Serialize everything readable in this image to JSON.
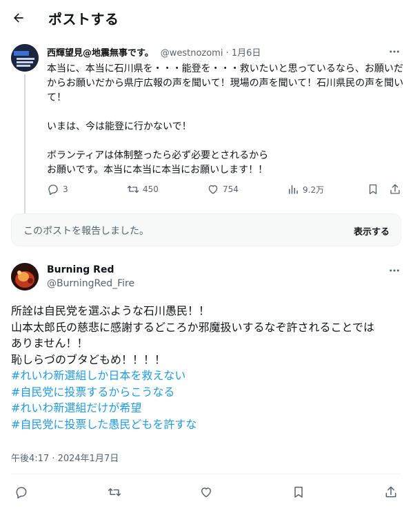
{
  "header": {
    "title": "ポストする"
  },
  "parent_post": {
    "author_name": "西輝望見@地震無事です。",
    "handle_date": "@westnozomi · 1月6日",
    "body": "本当に、本当に石川県を・・・能登を・・・救いたいと思っているなら、お願いだからお願いだから県庁広報の声を聞いて！現場の声を聞いて！石川県民の声を聞いて！\n\nいまは、今は能登に行かないで！\n\nボランティアは体制整ったら必ず必要とされるから\nお願いです。本当に本当に本当にお願いします！！",
    "stats": {
      "replies": "3",
      "reposts": "450",
      "likes": "754",
      "views": "9.2万"
    }
  },
  "notice": {
    "text": "このポストを報告しました。",
    "button": "表示する"
  },
  "main_post": {
    "author_name": "Burning Red",
    "handle": "@BurningRed_Fire",
    "lines": [
      "所詮は自民党を選ぶような石川愚民！！",
      "山本太郎氏の慈悲に感謝するどころか邪魔扱いするなぞ許されることでは",
      "ありません！！",
      "恥しらづのブタどもめ！！！！"
    ],
    "hashtags": [
      "#れいわ新選組しか日本を救えない",
      "#自民党に投票するからこうなる",
      "#れいわ新選組だけが希望",
      "#自民党に投票した愚民どもを許すな"
    ],
    "timestamp": "午後4:17 · 2024年1月7日"
  },
  "colors": {
    "accent": "#1d9bf0",
    "secondary_text": "#536471",
    "border": "#eff3f4"
  },
  "icons": [
    "back-arrow-icon",
    "more-icon",
    "reply-icon",
    "repost-icon",
    "like-icon",
    "views-icon",
    "bookmark-icon",
    "share-icon"
  ]
}
